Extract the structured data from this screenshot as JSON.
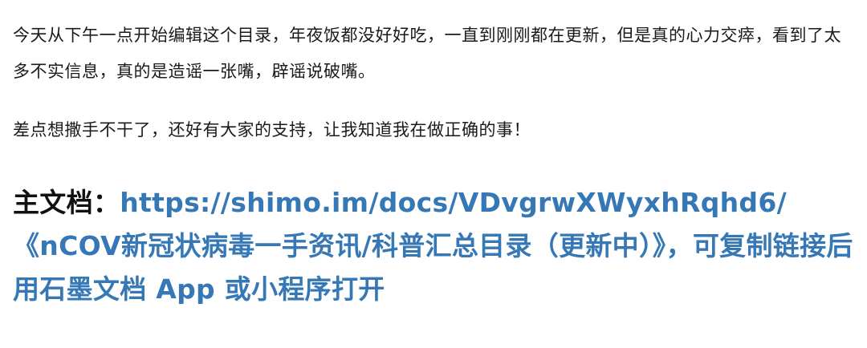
{
  "paragraphs": [
    "今天从下午一点开始编辑这个目录，年夜饭都没好好吃，一直到刚刚都在更新，但是真的心力交瘁，看到了太多不实信息，真的是造谣一张嘴，辟谣说破嘴。",
    "差点想撒手不干了，还好有大家的支持，让我知道我在做正确的事！"
  ],
  "main_doc": {
    "label": "主文档：",
    "url": "https://shimo.im/docs/VDvgrwXWyxhRqhd6/",
    "description": "《nCOV新冠状病毒一手资讯/科普汇总目录（更新中）》，可复制链接后用石墨文档 App 或小程序打开"
  },
  "colors": {
    "text": "#1a1a1a",
    "link": "#3578b5"
  }
}
